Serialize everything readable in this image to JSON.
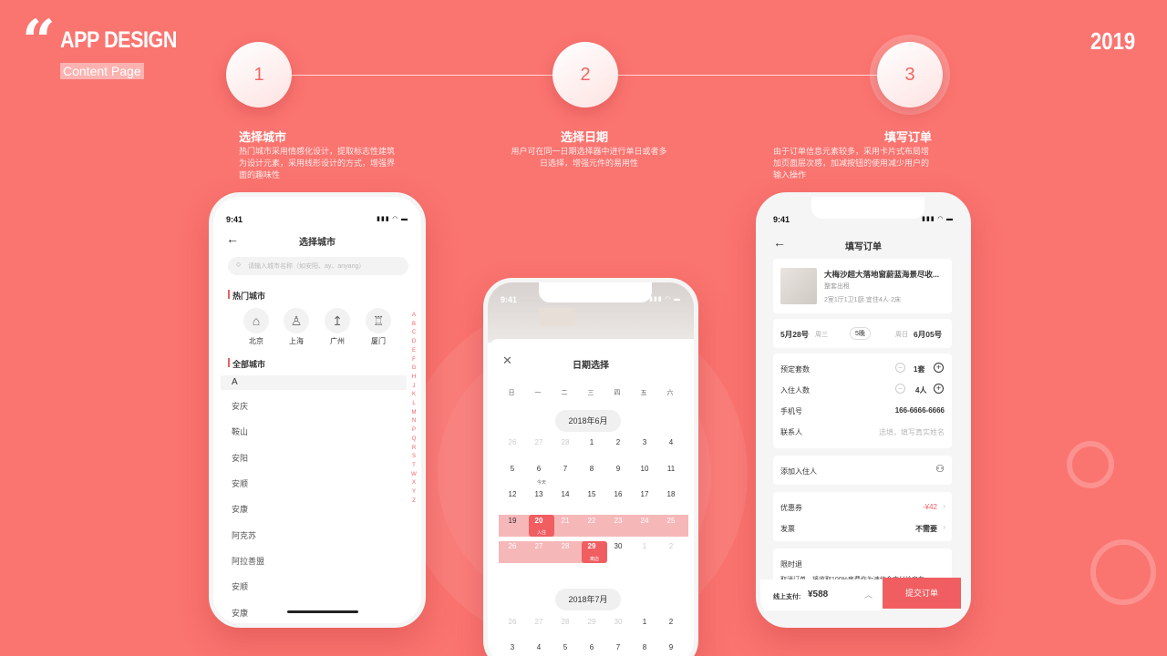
{
  "header": {
    "brand": "APP DESIGN",
    "subtitle": "Content Page",
    "year": "2019"
  },
  "steps": [
    {
      "num": "1",
      "title": "选择城市",
      "desc": "热门城市采用情感化设计，提取标志性建筑为设计元素，采用线形设计的方式，增强界面的趣味性"
    },
    {
      "num": "2",
      "title": "选择日期",
      "desc": "用户可在同一日期选择器中进行单日或者多日选择，增强元件的易用性"
    },
    {
      "num": "3",
      "title": "填写订单",
      "desc": "由于订单信息元素较多，采用卡片式布局增加页面层次感，加减按钮的使用减少用户的输入操作"
    }
  ],
  "city": {
    "time": "9:41",
    "title": "选择城市",
    "search_placeholder": "请输入城市名称（如安阳、ay、anyang）",
    "hot_label": "热门城市",
    "hot": [
      "北京",
      "上海",
      "广州",
      "厦门"
    ],
    "all_label": "全部城市",
    "letter": "A",
    "cities": [
      "安庆",
      "鞍山",
      "安阳",
      "安顺",
      "安康",
      "阿克苏",
      "阿拉善盟",
      "安顺",
      "安康"
    ],
    "index": [
      "A",
      "B",
      "C",
      "D",
      "E",
      "F",
      "G",
      "H",
      "J",
      "K",
      "L",
      "M",
      "N",
      "P",
      "Q",
      "R",
      "S",
      "T",
      "W",
      "X",
      "Y",
      "Z"
    ]
  },
  "date": {
    "time": "9:41",
    "title": "日期选择",
    "weekdays": [
      "日",
      "一",
      "二",
      "三",
      "四",
      "五",
      "六"
    ],
    "month1": "2018年6月",
    "month2": "2018年7月",
    "june": [
      [
        "26",
        "27",
        "28",
        "1",
        "2",
        "3",
        "4"
      ],
      [
        "5",
        "6",
        "7",
        "8",
        "9",
        "10",
        "11"
      ],
      [
        "12",
        "13",
        "14",
        "15",
        "16",
        "17",
        "18"
      ],
      [
        "19",
        "20",
        "21",
        "22",
        "23",
        "24",
        "25"
      ],
      [
        "26",
        "27",
        "28",
        "29",
        "30",
        "1",
        "2"
      ]
    ],
    "july": [
      [
        "26",
        "27",
        "28",
        "29",
        "30",
        "1",
        "2"
      ],
      [
        "3",
        "4",
        "5",
        "6",
        "7",
        "8",
        "9"
      ]
    ],
    "today_label": "今天",
    "checkin_label": "入住",
    "checkout_label": "离店"
  },
  "order": {
    "time": "9:41",
    "title": "填写订单",
    "hotel_name": "大梅沙超大落地窗蔚蓝海景尽收...",
    "hotel_type": "整套出租",
    "hotel_spec": "2室1厅1卫1厨·宜住4人·2床",
    "checkin": "5月28号",
    "checkin_day": "周三",
    "nights": "5晚",
    "checkout_day": "周日",
    "checkout": "6月05号",
    "rooms_label": "预定套数",
    "rooms": "1套",
    "guests_label": "入住人数",
    "guests": "4人",
    "phone_label": "手机号",
    "phone": "166-6666-6666",
    "contact_label": "联系人",
    "contact_placeholder": "选填，填写真实姓名",
    "add_guest": "添加入住人",
    "coupon_label": "优惠券",
    "coupon": "-¥42",
    "invoice_label": "发票",
    "invoice": "不需要",
    "refund_label": "限时退",
    "refund_text": "取消订单，将收取100%房费作为违约金支付给房东",
    "pay_label": "线上支付:",
    "pay_amount": "¥588",
    "submit": "提交订单"
  },
  "colors": {
    "bg": "#fa7470",
    "accent": "#f05e62",
    "range": "#f6b7b8"
  }
}
